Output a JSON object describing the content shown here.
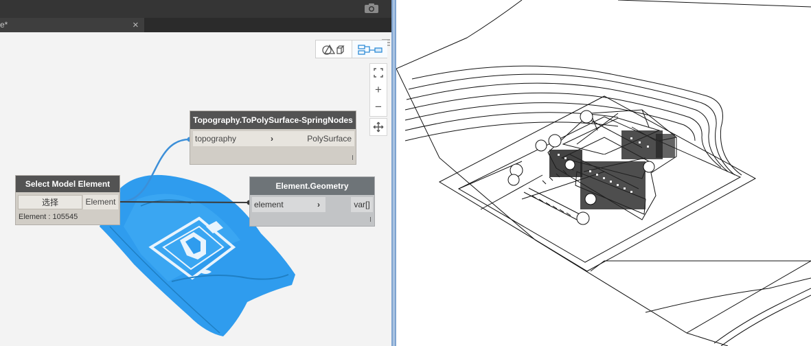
{
  "window": {
    "tab_title": "e*",
    "tab_close": "×"
  },
  "view_toggle": {
    "geometry_view_icon": "geometry-view-icon",
    "graph_view_icon": "graph-view-icon",
    "active": "graph"
  },
  "zoom_controls": {
    "fit": "fit-view-icon",
    "zoom_in": "+",
    "zoom_out": "−",
    "pan": "pan-icon"
  },
  "nodes": {
    "topography": {
      "title": "Topography.ToPolySurface-SpringNodes",
      "input": "topography",
      "output": "PolySurface"
    },
    "select_model_element": {
      "title": "Select Model Element",
      "button": "选择",
      "output": "Element",
      "info": "Element : 105545"
    },
    "element_geometry": {
      "title": "Element.Geometry",
      "input": "element",
      "output": "var[]"
    }
  },
  "colors": {
    "node_header": "#535353",
    "geometry_node_header": "#6e7478",
    "wire_blue": "#3c8fd8",
    "preview_blue": "#2f9cee",
    "panel_divider": "#7fa3cf"
  }
}
